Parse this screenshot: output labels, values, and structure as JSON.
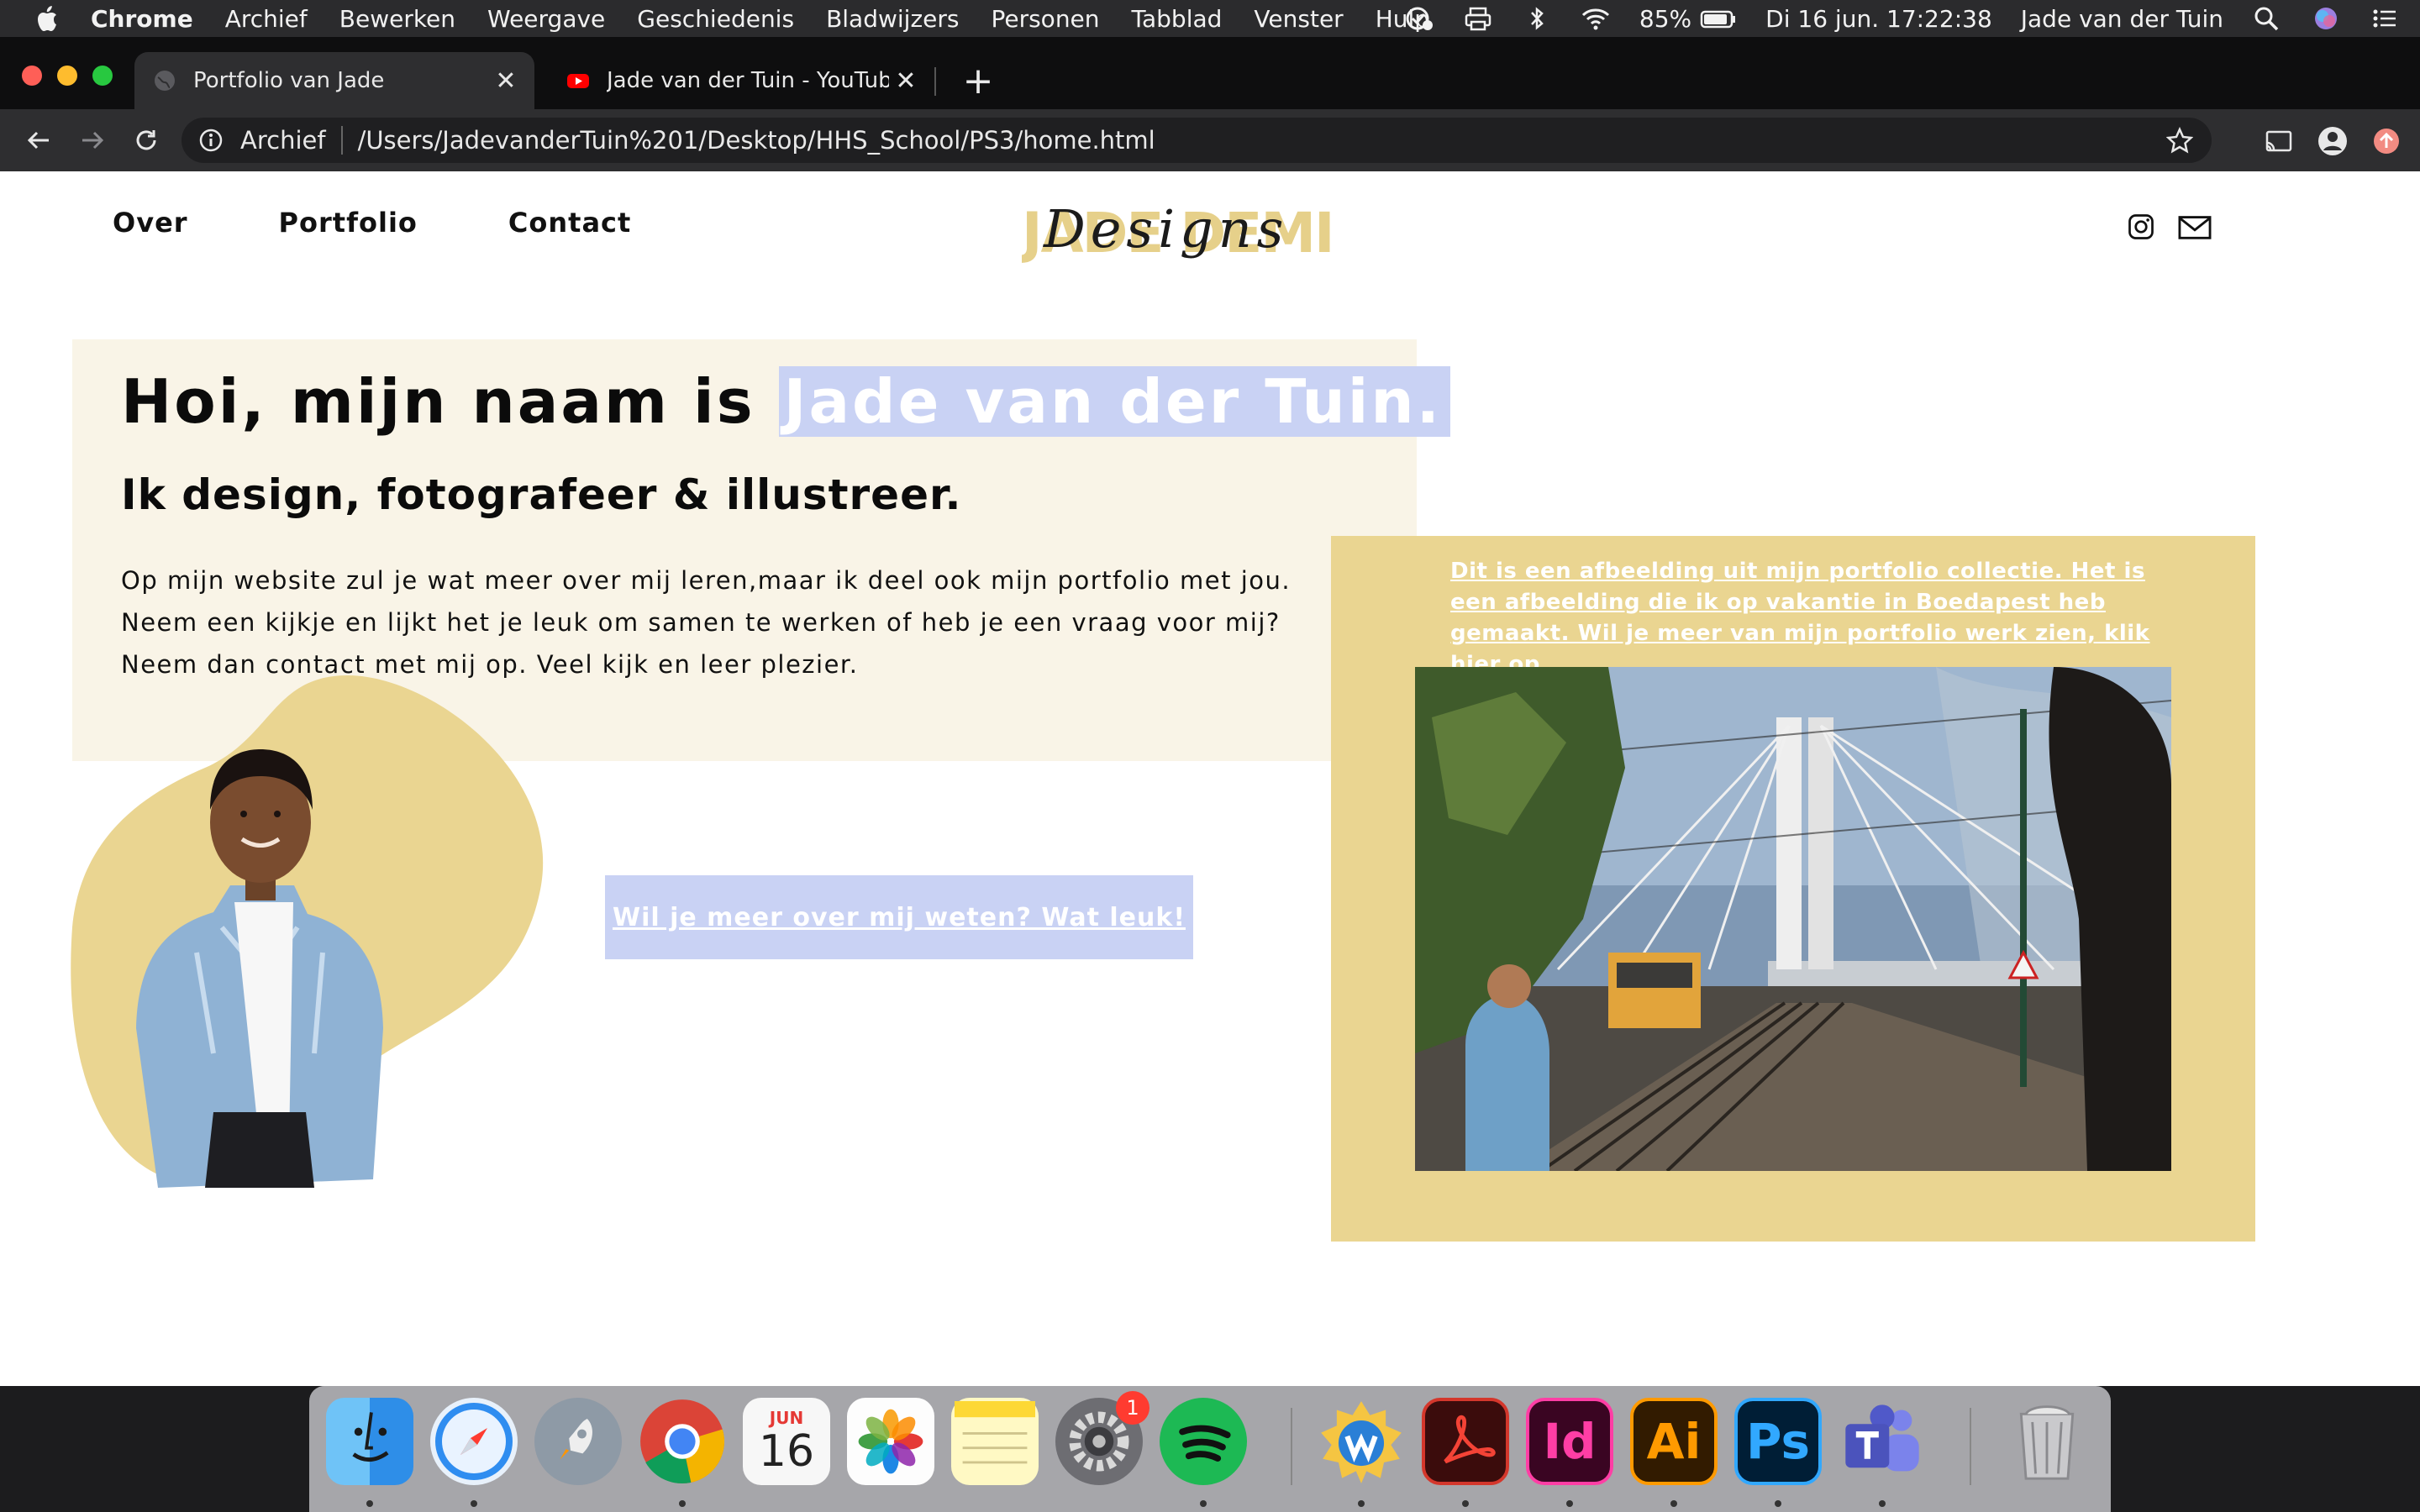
{
  "menubar": {
    "app": "Chrome",
    "items": [
      "Archief",
      "Bewerken",
      "Weergave",
      "Geschiedenis",
      "Bladwijzers",
      "Personen",
      "Tabblad",
      "Venster",
      "Hulp"
    ],
    "battery": "85%",
    "datetime": "Di 16 jun.  17:22:38",
    "user": "Jade van der Tuin"
  },
  "tabs": [
    {
      "title": "Portfolio van Jade"
    },
    {
      "title": "Jade van der Tuin - YouTube"
    }
  ],
  "address": {
    "chip": "Archief",
    "url": "/Users/JadevanderTuin%201/Desktop/HHS_School/PS3/home.html"
  },
  "site": {
    "nav": [
      "Over",
      "Portfolio",
      "Contact"
    ],
    "logo_text": "JADE DEMI",
    "logo_script": "Designs",
    "headline_prefix": "Hoi, mijn naam is",
    "headline_name": "Jade van der Tuin.",
    "subhead": "Ik design, fotografeer &  illustreer.",
    "body_lines": [
      "Op mijn website zul je wat meer over mij leren,maar ik deel ook mijn portfolio met jou.",
      "Neem een kijkje en lijkt het je leuk om samen te werken of heb je een vraag voor mij?",
      "Neem dan contact met mij op. Veel kijk en leer plezier."
    ],
    "cta_button": "Wil je meer over mij weten? Wat leuk!",
    "photo_caption": "Dit is een afbeelding uit mijn portfolio collectie. Het is een afbeelding die ik op vakantie in Boedapest heb gemaakt. Wil je meer van mijn portfolio werk zien, klik hier op."
  },
  "dock": {
    "calendar_month": "JUN",
    "calendar_day": "16",
    "settings_badge": "1",
    "apps": [
      "Finder",
      "Safari",
      "Launchpad",
      "Chrome",
      "Agenda",
      "Foto's",
      "Notities",
      "Systeemvoorkeuren",
      "Spotify",
      "Wunderlist",
      "Acrobat",
      "InDesign",
      "Illustrator",
      "Photoshop",
      "Teams",
      "Prullenmand"
    ]
  },
  "colors": {
    "accent_blue": "#c9d2f4",
    "mustard": "#ead591",
    "cream": "#f9f4e7"
  }
}
